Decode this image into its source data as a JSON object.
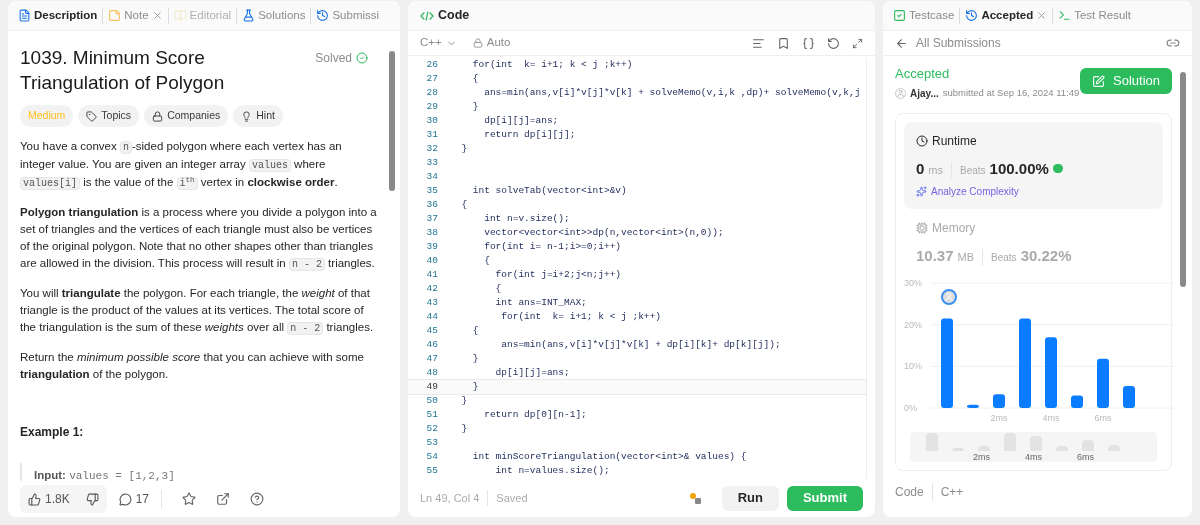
{
  "left_tabs": [
    {
      "label": "Description",
      "selected": true,
      "disabled": false,
      "closable": false
    },
    {
      "label": "Note",
      "selected": false,
      "disabled": false,
      "closable": true
    },
    {
      "label": "Editorial",
      "selected": false,
      "disabled": true,
      "closable": false
    },
    {
      "label": "Solutions",
      "selected": false,
      "disabled": false,
      "closable": false
    },
    {
      "label": "Submissi",
      "selected": false,
      "disabled": false,
      "closable": false
    }
  ],
  "problem": {
    "title": "1039. Minimum Score Triangulation of Polygon",
    "status": "Solved",
    "solved": true,
    "tags": [
      {
        "label": "Medium",
        "kind": "difficulty"
      },
      {
        "label": "Topics",
        "kind": "tag"
      },
      {
        "label": "Companies",
        "kind": "lock"
      },
      {
        "label": "Hint",
        "kind": "bulb"
      }
    ],
    "paragraphs": [
      [
        {
          "kind": "text",
          "text": "You have a convex "
        },
        {
          "kind": "code",
          "text": "n"
        },
        {
          "kind": "text",
          "text": "-sided polygon where each vertex has an integer value. You are given an integer array "
        },
        {
          "kind": "code",
          "text": "values"
        },
        {
          "kind": "text",
          "text": " where "
        },
        {
          "kind": "code",
          "text": "values[i]"
        },
        {
          "kind": "text",
          "text": " is the value of the "
        },
        {
          "kind": "code",
          "text": "i$^{th}$"
        },
        {
          "kind": "text",
          "text": " vertex in **clockwise order**."
        }
      ],
      [
        {
          "kind": "text",
          "text": "**Polygon triangulation** is a process where you divide a polygon into a set of triangles and the vertices of each triangle must also be vertices of the original polygon. Note that no other shapes other than triangles are allowed in the division. This process will result in "
        },
        {
          "kind": "code",
          "text": "n - 2"
        },
        {
          "kind": "text",
          "text": " triangles."
        }
      ],
      [
        {
          "kind": "text",
          "text": "You will **triangulate** the polygon. For each triangle, the *weight* of that triangle is the product of the values at its vertices. The total score of the triangulation is the sum of these *weights* over all "
        },
        {
          "kind": "code",
          "text": "n - 2"
        },
        {
          "kind": "text",
          "text": " triangles."
        }
      ],
      [
        {
          "kind": "text",
          "text": "Return the *minimum possible score* that you can achieve with some **triangulation** of the polygon."
        }
      ]
    ],
    "example_title": "Example 1:",
    "example_label": "Input:",
    "example_value": "values = [1,2,3]"
  },
  "actions": {
    "likes": "1.8K",
    "comments": "17"
  },
  "code": {
    "title": "Code",
    "language": "C++",
    "mode": "Auto",
    "lines": [
      {
        "no": "26",
        "text": "    for(int  k= i+1; k < j ;k++)",
        "current": false
      },
      {
        "no": "27",
        "text": "    {",
        "current": false
      },
      {
        "no": "28",
        "text": "      ans=min(ans,v[i]*v[j]*v[k] + solveMemo(v,i,k ,dp)+ solveMemo(v,k,j",
        "current": false
      },
      {
        "no": "29",
        "text": "    }",
        "current": false
      },
      {
        "no": "30",
        "text": "      dp[i][j]=ans;",
        "current": false
      },
      {
        "no": "31",
        "text": "      return dp[i][j];",
        "current": false
      },
      {
        "no": "32",
        "text": "  }",
        "current": false
      },
      {
        "no": "33",
        "current": false
      },
      {
        "no": "34",
        "current": false
      },
      {
        "no": "35",
        "text": "    int solveTab(vector<int>&v)",
        "current": false
      },
      {
        "no": "36",
        "text": "  {",
        "current": false
      },
      {
        "no": "37",
        "text": "      int n=v.size();",
        "current": false
      },
      {
        "no": "38",
        "text": "      vector<vector<int>>dp(n,vector<int>(n,0));",
        "current": false
      },
      {
        "no": "39",
        "text": "      for(int i= n-1;i>=0;i++)",
        "current": false
      },
      {
        "no": "40",
        "text": "      {",
        "current": false
      },
      {
        "no": "41",
        "text": "        for(int j=i+2;j<n;j++)",
        "current": false
      },
      {
        "no": "42",
        "text": "        {",
        "current": false
      },
      {
        "no": "43",
        "text": "        int ans=INT_MAX;",
        "current": false
      },
      {
        "no": "44",
        "text": "         for(int  k= i+1; k < j ;k++)",
        "current": false
      },
      {
        "no": "45",
        "text": "    {",
        "current": false
      },
      {
        "no": "46",
        "text": "         ans=min(ans,v[i]*v[j]*v[k] + dp[i][k]+ dp[k][j]);",
        "current": false
      },
      {
        "no": "47",
        "text": "    }",
        "current": false
      },
      {
        "no": "48",
        "text": "        dp[i][j]=ans;",
        "current": false
      },
      {
        "no": "49",
        "text": "    }",
        "current": true
      },
      {
        "no": "50",
        "text": "  }",
        "current": false
      },
      {
        "no": "51",
        "text": "      return dp[0][n-1];",
        "current": false
      },
      {
        "no": "52",
        "text": "  }",
        "current": false
      },
      {
        "no": "53",
        "current": false
      },
      {
        "no": "54",
        "text": "    int minScoreTriangulation(vector<int>& values) {",
        "current": false
      },
      {
        "no": "55",
        "text": "        int n=values.size();",
        "current": false
      }
    ],
    "position": "Ln 49, Col 4",
    "saved": "Saved",
    "run": "Run",
    "submit": "Submit"
  },
  "right_tabs": [
    {
      "label": "Testcase",
      "selected": false,
      "closable": false
    },
    {
      "label": "Accepted",
      "selected": true,
      "closable": true
    },
    {
      "label": "Test Result",
      "selected": false,
      "closable": false
    }
  ],
  "submission": {
    "back": "All Submissions",
    "status": "Accepted",
    "user": "Ajay...",
    "submitted": "submitted at Sep 16, 2024 11:49",
    "solution_button": "Solution",
    "runtime": {
      "label": "Runtime",
      "value": "0",
      "unit": "ms",
      "beats_label": "Beats",
      "beats": "100.00%",
      "analyze": "Analyze Complexity",
      "selected": true
    },
    "memory": {
      "label": "Memory",
      "value": "10.37",
      "unit": "MB",
      "beats_label": "Beats",
      "beats": "30.22%",
      "selected": false
    },
    "chart_data": {
      "type": "bar",
      "categories": [
        null,
        null,
        "2ms",
        null,
        "4ms",
        null,
        "6ms",
        null
      ],
      "series": [
        {
          "color": "#0a7cff",
          "values": [
            21.5,
            0.8,
            3.3,
            21.5,
            17,
            3,
            11.8,
            5.3
          ]
        }
      ],
      "ylim": [
        0,
        30
      ],
      "yticks": [
        {
          "value": 0,
          "label": "0%"
        },
        {
          "value": 10,
          "label": "10%"
        },
        {
          "value": 20,
          "label": "20%"
        },
        {
          "value": 30,
          "label": "30%"
        }
      ]
    },
    "overview_ticks": [
      "2ms",
      "4ms",
      "6ms"
    ],
    "footer": [
      "Code",
      "C++"
    ]
  }
}
